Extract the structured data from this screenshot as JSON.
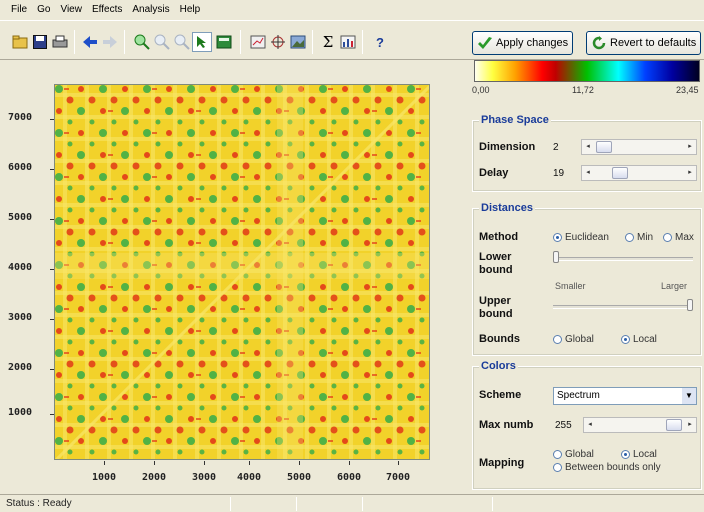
{
  "menu": [
    {
      "id": "file",
      "label": "File"
    },
    {
      "id": "go",
      "label": "Go"
    },
    {
      "id": "view",
      "label": "View"
    },
    {
      "id": "effects",
      "label": "Effects"
    },
    {
      "id": "analysis",
      "label": "Analysis"
    },
    {
      "id": "help",
      "label": "Help"
    }
  ],
  "toolbar": {
    "icons": [
      "open-folder-icon",
      "save-icon",
      "print-icon",
      "back-arrow-icon",
      "forward-arrow-icon",
      "zoom-in-icon",
      "zoom-reset-icon",
      "zoom-out-icon",
      "pointer-icon",
      "table-icon",
      "chart-export-icon",
      "crosshair-icon",
      "image-icon",
      "sigma-icon",
      "statistics-icon",
      "help-question-icon"
    ],
    "apply_label": "Apply changes",
    "revert_label": "Revert to defaults"
  },
  "plot": {
    "y_ticks": [
      "7000",
      "6000",
      "5000",
      "4000",
      "3000",
      "2000",
      "1000"
    ],
    "x_ticks": [
      "1000",
      "2000",
      "3000",
      "4000",
      "5000",
      "6000",
      "7000"
    ]
  },
  "colorbar": {
    "min": "0,00",
    "mid": "11,72",
    "max": "23,45"
  },
  "phase_space": {
    "title": "Phase Space",
    "dimension_label": "Dimension",
    "dimension_value": "2",
    "delay_label": "Delay",
    "delay_value": "19"
  },
  "distances": {
    "title": "Distances",
    "method_label": "Method",
    "method_options": [
      "Euclidean",
      "Min",
      "Max"
    ],
    "method_selected": "Euclidean",
    "lower_label": "Lower bound",
    "smaller_label": "Smaller",
    "larger_label": "Larger",
    "upper_label": "Upper bound",
    "bounds_label": "Bounds",
    "bounds_options": [
      "Global",
      "Local"
    ],
    "bounds_selected": "Local"
  },
  "colors": {
    "title": "Colors",
    "scheme_label": "Scheme",
    "scheme_value": "Spectrum",
    "maxnumb_label": "Max numb",
    "maxnumb_value": "255",
    "mapping_label": "Mapping",
    "mapping_options": [
      "Global",
      "Local",
      "Between bounds only"
    ],
    "mapping_selected": "Local"
  },
  "status": {
    "text": "Status : Ready"
  },
  "palette": {
    "bg": "#f2d22a",
    "light": "#f8e66a",
    "red": "#e23a18",
    "green": "#3fae48",
    "accent": "#1a3c9a"
  }
}
